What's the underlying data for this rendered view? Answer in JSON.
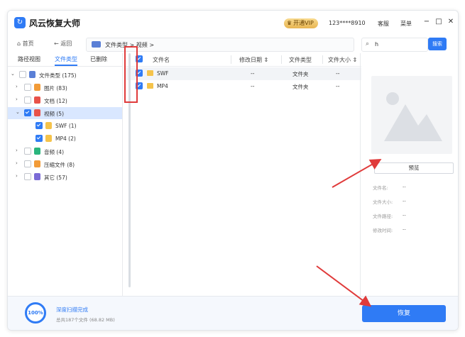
{
  "app": {
    "title": "风云恢复大师",
    "vip_label": "开通VIP",
    "phone": "123****8910",
    "service": "客服",
    "menu": "菜单"
  },
  "nav": {
    "home": "首页",
    "back": "返回",
    "path": "文件类型 > 视频 >"
  },
  "search": {
    "value": "h",
    "button": "搜索"
  },
  "tabs": [
    "路径视图",
    "文件类型",
    "已删除"
  ],
  "tree": [
    {
      "label": "文件类型 (175)",
      "checked": false,
      "color": "#5a7fd6"
    },
    {
      "label": "图片 (83)",
      "checked": false,
      "color": "#f29b38"
    },
    {
      "label": "文档 (12)",
      "checked": false,
      "color": "#e8524a"
    },
    {
      "label": "视频 (5)",
      "checked": true,
      "color": "#e8524a"
    },
    {
      "label": "SWF (1)",
      "checked": true,
      "color": "#f5c34b"
    },
    {
      "label": "MP4 (2)",
      "checked": true,
      "color": "#f5c34b"
    },
    {
      "label": "音频 (4)",
      "checked": false,
      "color": "#2ab57d"
    },
    {
      "label": "压缩文件 (8)",
      "checked": false,
      "color": "#f29b38"
    },
    {
      "label": "其它 (57)",
      "checked": false,
      "color": "#7b6bd6"
    }
  ],
  "list": {
    "headers": {
      "name": "文件名",
      "date": "修改日期",
      "type": "文件类型",
      "size": "文件大小"
    },
    "rows": [
      {
        "name": "SWF",
        "date": "--",
        "type": "文件夹",
        "size": "--"
      },
      {
        "name": "MP4",
        "date": "--",
        "type": "文件夹",
        "size": "--"
      }
    ]
  },
  "preview": {
    "button": "预览",
    "meta": [
      {
        "label": "文件名:",
        "value": "--"
      },
      {
        "label": "文件大小:",
        "value": "--"
      },
      {
        "label": "文件路径:",
        "value": "--"
      },
      {
        "label": "修改时间:",
        "value": "--"
      }
    ]
  },
  "bottom": {
    "progress": "100%",
    "scan_title": "深度扫描完成",
    "scan_sub": "总共187个文件 (68.82 MB)",
    "recover": "恢复"
  },
  "colors": {
    "accent": "#2f7bf5",
    "annotation": "#e03b3b"
  }
}
